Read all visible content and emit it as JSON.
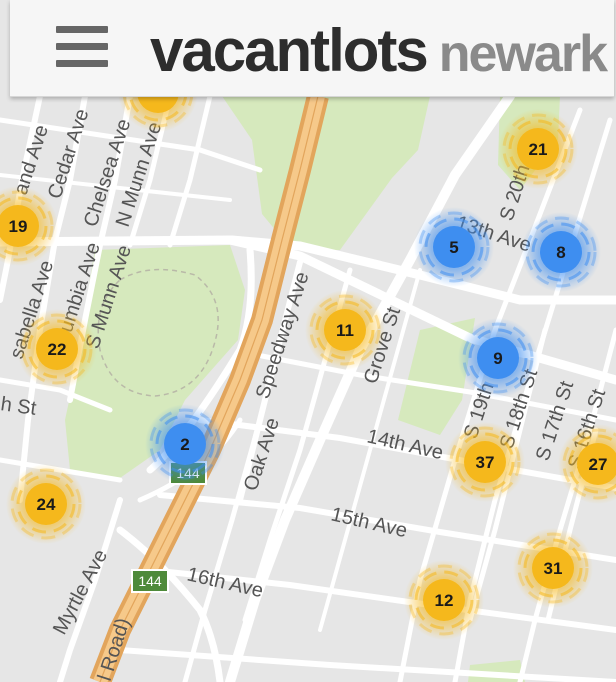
{
  "header": {
    "menu_icon": "hamburger-menu-icon",
    "logo_primary": "vacantlots",
    "logo_secondary": "newark"
  },
  "map": {
    "colors": {
      "background": "#e6e6e6",
      "road": "#ffffff",
      "park": "#d6e9bd",
      "highway": "#f6c98a",
      "highway_edge": "#e2a55c",
      "cluster_yellow": "#f5b81c",
      "cluster_blue": "#3e8ef0",
      "shield": "#4e8a3a"
    },
    "street_labels": [
      {
        "id": "street-hand-ave",
        "text": "and Ave"
      },
      {
        "id": "street-cedar-ave",
        "text": "Cedar Ave"
      },
      {
        "id": "street-chelsea-ave",
        "text": "Chelsea Ave"
      },
      {
        "id": "street-n-munn-ave",
        "text": "N Munn Ave"
      },
      {
        "id": "street-isabella-ave",
        "text": "sabella Ave"
      },
      {
        "id": "street-columbia-ave",
        "text": "Columbia Ave"
      },
      {
        "id": "street-s-munn-ave",
        "text": "S Munn Ave"
      },
      {
        "id": "street-h-st",
        "text": "h St"
      },
      {
        "id": "street-speedway-ave",
        "text": "Speedway Ave"
      },
      {
        "id": "street-grove-st",
        "text": "Grove St"
      },
      {
        "id": "street-oak-ave",
        "text": "Oak Ave"
      },
      {
        "id": "street-14th-ave",
        "text": "14th Ave"
      },
      {
        "id": "street-15th-ave",
        "text": "15th Ave"
      },
      {
        "id": "street-16th-ave",
        "text": "16th Ave"
      },
      {
        "id": "street-myrtle-ave",
        "text": "Myrtle Ave"
      },
      {
        "id": "street-13th-ave",
        "text": "13th Ave"
      },
      {
        "id": "street-s-20th-st",
        "text": "S 20th St"
      },
      {
        "id": "street-s-19th-st",
        "text": "S 19th St"
      },
      {
        "id": "street-s-18th-st",
        "text": "S 18th St"
      },
      {
        "id": "street-s-17th-st",
        "text": "S 17th St"
      },
      {
        "id": "street-s-16th-st",
        "text": "S 16th St"
      },
      {
        "id": "street-road",
        "text": "l Road)"
      }
    ],
    "route_shields": [
      {
        "id": "route-shield-upper",
        "text": "144"
      },
      {
        "id": "route-shield-lower",
        "text": "144"
      }
    ],
    "clusters": [
      {
        "id": "cluster-19",
        "count": "19",
        "color": "yellow"
      },
      {
        "id": "cluster-21",
        "count": "21",
        "color": "yellow"
      },
      {
        "id": "cluster-5",
        "count": "5",
        "color": "blue"
      },
      {
        "id": "cluster-8",
        "count": "8",
        "color": "blue"
      },
      {
        "id": "cluster-22",
        "count": "22",
        "color": "yellow"
      },
      {
        "id": "cluster-11",
        "count": "11",
        "color": "yellow"
      },
      {
        "id": "cluster-9",
        "count": "9",
        "color": "blue"
      },
      {
        "id": "cluster-2",
        "count": "2",
        "color": "blue"
      },
      {
        "id": "cluster-37",
        "count": "37",
        "color": "yellow"
      },
      {
        "id": "cluster-27",
        "count": "27",
        "color": "yellow"
      },
      {
        "id": "cluster-24",
        "count": "24",
        "color": "yellow"
      },
      {
        "id": "cluster-31",
        "count": "31",
        "color": "yellow"
      },
      {
        "id": "cluster-12",
        "count": "12",
        "color": "yellow"
      },
      {
        "id": "cluster-partial-top",
        "count": "",
        "color": "yellow"
      }
    ]
  }
}
